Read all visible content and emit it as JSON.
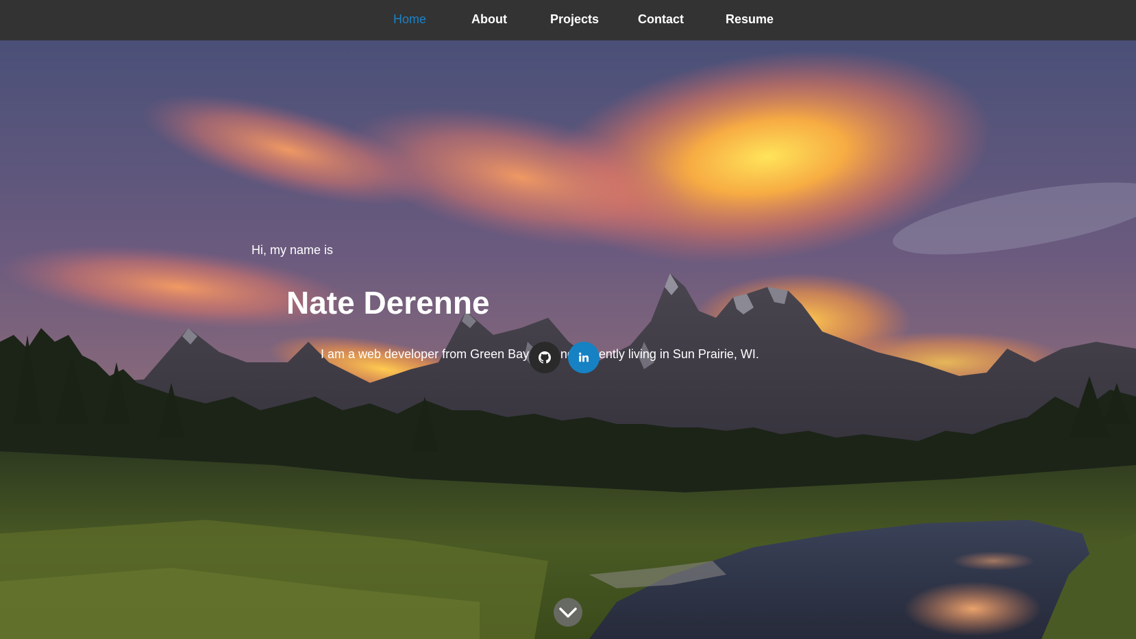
{
  "nav": {
    "items": [
      {
        "label": "Home",
        "active": true
      },
      {
        "label": "About",
        "active": false
      },
      {
        "label": "Projects",
        "active": false
      },
      {
        "label": "Contact",
        "active": false
      },
      {
        "label": "Resume",
        "active": false
      }
    ]
  },
  "hero": {
    "greeting": "Hi, my name is",
    "name": "Nate Derenne",
    "tagline": "I am a web developer from Green Bay, WI and currently living in Sun Prairie, WI.",
    "background": "sunset mountain landscape with river"
  },
  "social": {
    "github": {
      "icon": "github-icon",
      "color": "#2a2a2a"
    },
    "linkedin": {
      "icon": "linkedin-icon",
      "color": "#1682c4"
    }
  },
  "scroll": {
    "icon": "chevron-down-icon"
  },
  "colors": {
    "navbar_bg": "#333333",
    "nav_active": "#1a82c8",
    "nav_text": "#ffffff"
  }
}
